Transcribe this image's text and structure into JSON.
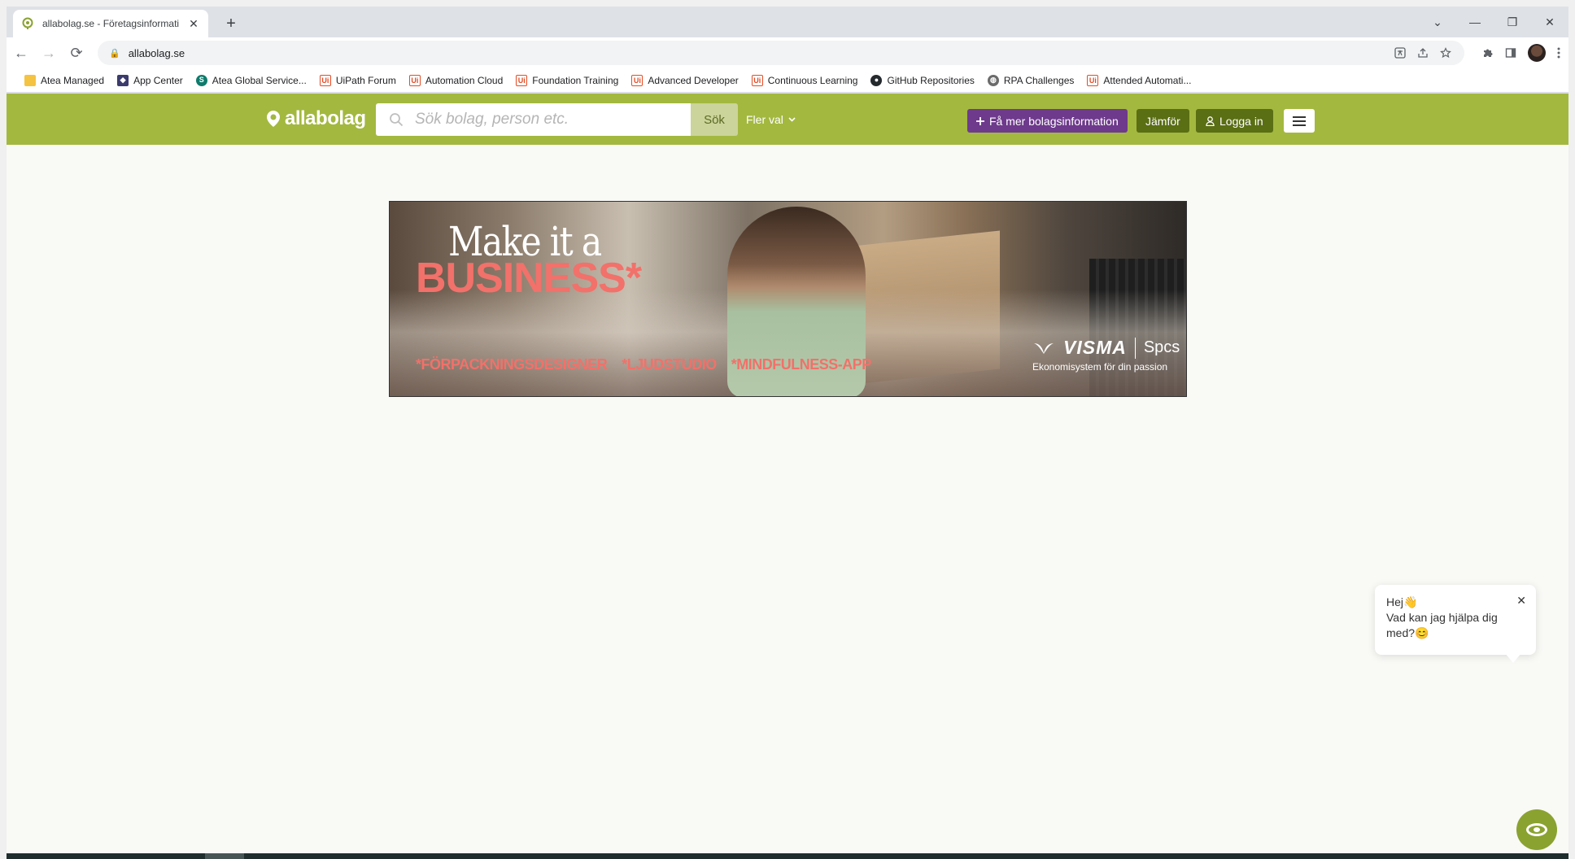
{
  "browser": {
    "tab": {
      "title": "allabolag.se - Företagsinformation",
      "close_glyph": "✕"
    },
    "new_tab_glyph": "+",
    "window_controls": [
      "⌄",
      "—",
      "❐",
      "✕"
    ],
    "nav": {
      "back": "←",
      "forward": "→",
      "reload": "⟳"
    },
    "address": {
      "url": "allabolag.se",
      "lock_glyph": "🔒"
    },
    "bookmarks": [
      {
        "label": "Atea Managed",
        "icon": "folder"
      },
      {
        "label": "App Center",
        "icon": "app"
      },
      {
        "label": "Atea Global Service...",
        "icon": "sp"
      },
      {
        "label": "UiPath Forum",
        "icon": "ui"
      },
      {
        "label": "Automation Cloud",
        "icon": "ui"
      },
      {
        "label": "Foundation Training",
        "icon": "ui"
      },
      {
        "label": "Advanced Developer",
        "icon": "ui"
      },
      {
        "label": "Continuous Learning",
        "icon": "ui"
      },
      {
        "label": "GitHub Repositories",
        "icon": "gh"
      },
      {
        "label": "RPA Challenges",
        "icon": "globe"
      },
      {
        "label": "Attended Automati...",
        "icon": "ui"
      }
    ]
  },
  "site": {
    "logo_text": "allabolag",
    "search": {
      "placeholder": "Sök bolag, person etc.",
      "value": ""
    },
    "search_button": "Sök",
    "more_menu": "Fler val",
    "cta_info": "Få mer bolagsinformation",
    "cta_compare": "Jämför",
    "cta_login": "Logga in",
    "colors": {
      "brand": "#a3b83f",
      "purple": "#6e3a8c",
      "dark_green": "#5a6e14"
    }
  },
  "ad": {
    "headline_1": "Make it a",
    "headline_2": "BUSINESS*",
    "tags": [
      "*FÖRPACKNINGSDESIGNER",
      "*LJUDSTUDIO",
      "*MINDFULNESS-APP"
    ],
    "brand": "VISMA",
    "brand_sub": "Spcs",
    "slogan": "Ekonomisystem för din passion"
  },
  "chat": {
    "greeting": "Hej👋",
    "message": "Vad kan jag hjälpa dig med?😊",
    "close_glyph": "✕"
  }
}
